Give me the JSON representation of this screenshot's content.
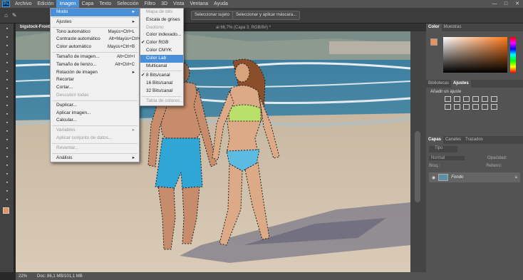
{
  "app": {
    "logo": "Ps",
    "menus": [
      "Archivo",
      "Edición",
      "Imagen",
      "Capa",
      "Texto",
      "Selección",
      "Filtro",
      "3D",
      "Vista",
      "Ventana",
      "Ayuda"
    ],
    "active_menu": "Imagen"
  },
  "window_controls": [
    "—",
    "□",
    "✕"
  ],
  "options_bar": {
    "select_subject": "Seleccionar sujeto",
    "select_mask": "Seleccionar y aplicar máscara..."
  },
  "document": {
    "tab": "bigstock-Front-vi",
    "tab_suffix": "al 66,7% (Capa 3, RGB/8#) *",
    "zoom": "22%",
    "doc_info": "Doc: 86,1 MB/101,1 MB"
  },
  "image_menu": [
    {
      "label": "Modo",
      "arrow": "▸",
      "hl": true
    },
    {
      "sep": true
    },
    {
      "label": "Ajustes",
      "arrow": "▸"
    },
    {
      "sep": true
    },
    {
      "label": "Tono automático",
      "shortcut": "Mayús+Ctrl+L"
    },
    {
      "label": "Contraste automático",
      "shortcut": "Alt+Mayús+Ctrl+L"
    },
    {
      "label": "Color automático",
      "shortcut": "Mayús+Ctrl+B"
    },
    {
      "sep": true
    },
    {
      "label": "Tamaño de imagen...",
      "shortcut": "Alt+Ctrl+I"
    },
    {
      "label": "Tamaño de lienzo...",
      "shortcut": "Alt+Ctrl+C"
    },
    {
      "label": "Rotación de imagen",
      "arrow": "▸"
    },
    {
      "label": "Recortar"
    },
    {
      "label": "Cortar..."
    },
    {
      "label": "Descubrir todas",
      "dis": true
    },
    {
      "sep": true
    },
    {
      "label": "Duplicar..."
    },
    {
      "label": "Aplicar imagen..."
    },
    {
      "label": "Calcular..."
    },
    {
      "sep": true
    },
    {
      "label": "Variables",
      "arrow": "▸",
      "dis": true
    },
    {
      "label": "Aplicar conjunto de datos...",
      "dis": true
    },
    {
      "sep": true
    },
    {
      "label": "Reventar...",
      "dis": true
    },
    {
      "sep": true
    },
    {
      "label": "Análisis",
      "arrow": "▸"
    }
  ],
  "mode_menu": [
    {
      "label": "Mapa de bits",
      "dis": true
    },
    {
      "label": "Escala de grises"
    },
    {
      "label": "Duotono",
      "dis": true
    },
    {
      "label": "Color indexado..."
    },
    {
      "label": "Color RGB",
      "check": true
    },
    {
      "label": "Color CMYK"
    },
    {
      "label": "Color Lab",
      "hl": true
    },
    {
      "label": "Multicanal"
    },
    {
      "sep": true
    },
    {
      "label": "8 Bits/canal",
      "check": true
    },
    {
      "label": "16 Bits/canal"
    },
    {
      "label": "32 Bits/canal"
    },
    {
      "sep": true
    },
    {
      "label": "Tabla de colores...",
      "dis": true
    }
  ],
  "panels": {
    "color_tabs": [
      "Color",
      "Muestras"
    ],
    "adj_tabs": [
      "Bibliotecas",
      "Ajustes"
    ],
    "adj_title": "Añadir un ajuste",
    "layers_tabs": [
      "Capas",
      "Canales",
      "Trazados"
    ],
    "kind": "Tipo",
    "blend": "Normal",
    "opacity_label": "Opacidad:",
    "lock_label": "Bloq.:",
    "fill_label": "Relleno:",
    "layer_name": "Fondo"
  },
  "colors": {
    "fg": "#e8925c",
    "bg": "#ffffff",
    "accent": "#4a90d9"
  }
}
